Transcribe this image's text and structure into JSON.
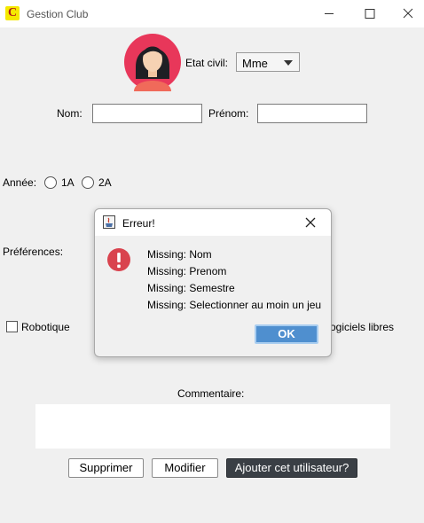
{
  "window": {
    "title": "Gestion Club",
    "app_icon_letter": "C"
  },
  "form": {
    "etat_civil_label": "Etat civil:",
    "etat_civil_value": "Mme",
    "nom_label": "Nom:",
    "nom_value": "",
    "prenom_label": "Prénom:",
    "prenom_value": "",
    "annee_label": "Année:",
    "annee_options": [
      "1A",
      "2A"
    ],
    "preferences_label": "Préférences:",
    "pref_robotique": "Robotique",
    "pref_logiciels_visible": "ogiciels libres",
    "commentaire_label": "Commentaire:",
    "commentaire_value": ""
  },
  "buttons": {
    "supprimer": "Supprimer",
    "modifier": "Modifier",
    "ajouter": "Ajouter cet utilisateur?"
  },
  "dialog": {
    "title": "Erreur!",
    "messages": [
      "Missing: Nom",
      "Missing: Prenom",
      "Missing: Semestre",
      "Missing: Selectionner au moin un jeu"
    ],
    "ok_label": "OK"
  },
  "icons": {
    "app": "app-icon",
    "avatar": "female-avatar-icon",
    "error": "error-icon",
    "java": "java-cup-icon"
  },
  "colors": {
    "avatar_bg": "#e8375a",
    "error_red": "#d9434e",
    "ok_blue": "#4f8fcf",
    "primary_button": "#3a3f45"
  }
}
